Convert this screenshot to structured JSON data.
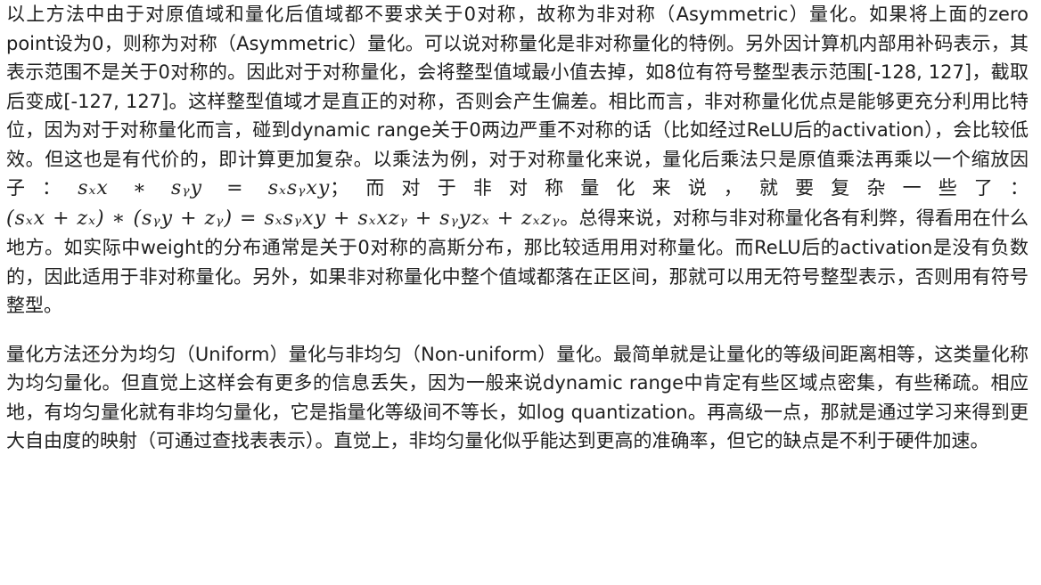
{
  "paragraphs": [
    {
      "segments": [
        {
          "kind": "text",
          "text": "以上方法中由于对原值域和量化后值域都不要求关于0对称，故称为非对称（Asymmetric）量化。如果将上面的zero point设为0，则称为对称（Asymmetric）量化。可以说对称量化是非对称量化的特例。另外因计算机内部用补码表示，其表示范围不是关于0对称的。因此对于对称量化，会将整型值域最小值去掉，如8位有符号整型表示范围[-128, 127]，截取后变成[-127, 127]。这样整型值域才是直正的对称，否则会产生偏差。相比而言，非对称量化优点是能够更充分利用比特位，因为对于对称量化而言，碰到dynamic range关于0两边严重不对称的话（比如经过ReLU后的activation），会比较低效。但这也是有代价的，即计算更加复杂。以乘法为例，对于对称量化来说，量化后乘法只是原值乘法再乘以一个缩放因子："
        },
        {
          "kind": "math",
          "text": "sₓx ∗ sᵧy = sₓsᵧxy"
        },
        {
          "kind": "text",
          "text": "；而对于非对称量化来说，就要复杂一些了："
        },
        {
          "kind": "math",
          "text": "(sₓx + zₓ) ∗ (sᵧy + zᵧ) = sₓsᵧxy + sₓxzᵧ + sᵧyzₓ + zₓzᵧ"
        },
        {
          "kind": "text",
          "text": "。总得来说，对称与非对称量化各有利弊，得看用在什么地方。如实际中weight的分布通常是关于0对称的高斯分布，那比较适用用对称量化。而ReLU后的activation是没有负数的，因此适用于非对称量化。另外，如果非对称量化中整个值域都落在正区间，那就可以用无符号整型表示，否则用有符号整型。"
        }
      ]
    },
    {
      "segments": [
        {
          "kind": "text",
          "text": "量化方法还分为均匀（Uniform）量化与非均匀（Non-uniform）量化。最简单就是让量化的等级间距离相等，这类量化称为均匀量化。但直觉上这样会有更多的信息丢失，因为一般来说dynamic range中肯定有些区域点密集，有些稀疏。相应地，有均匀量化就有非均匀量化，它是指量化等级间不等长，如log quantization。再高级一点，那就是通过学习来得到更大自由度的映射（可通过查找表表示）。直觉上，非均匀量化似乎能达到更高的准确率，但它的缺点是不利于硬件加速。"
        }
      ]
    }
  ]
}
